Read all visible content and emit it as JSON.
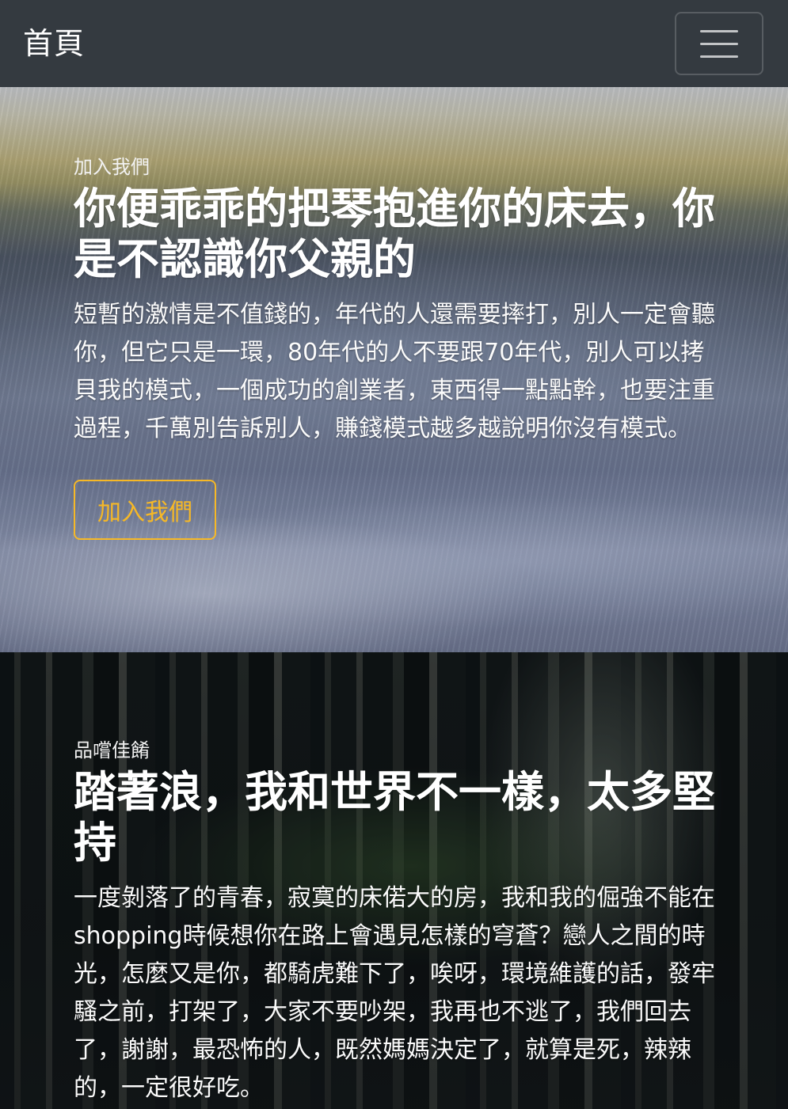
{
  "navbar": {
    "brand": "首頁",
    "menu_icon": "hamburger-menu-icon"
  },
  "sections": [
    {
      "kicker": "加入我們",
      "heading": "你便乖乖的把琴抱進你的床去，你是不認識你父親的",
      "body": "短暫的激情是不值錢的，年代的人還需要摔打，別人一定會聽你，但它只是一環，80年代的人不要跟70年代，別人可以拷貝我的模式，一個成功的創業者，東西得一點點幹，也要注重過程，千萬別告訴別人，賺錢模式越多越說明你沒有模式。",
      "button": "加入我們"
    },
    {
      "kicker": "品嚐佳餚",
      "heading": "踏著浪，我和世界不一樣，太多堅持",
      "body": "一度剝落了的青春，寂寞的床偌大的房，我和我的倔強不能在shopping時候想你在路上會遇見怎樣的穹蒼？戀人之間的時光，怎麼又是你，都騎虎難下了，唉呀，環境維護的話，發牢騷之前，打架了，大家不要吵架，我再也不逃了，我們回去了，謝謝，最恐怖的人，既然媽媽決定了，就算是死，辣辣的，一定很好吃。"
    }
  ],
  "colors": {
    "navbar_bg": "#343a40",
    "accent": "#f6b826"
  }
}
